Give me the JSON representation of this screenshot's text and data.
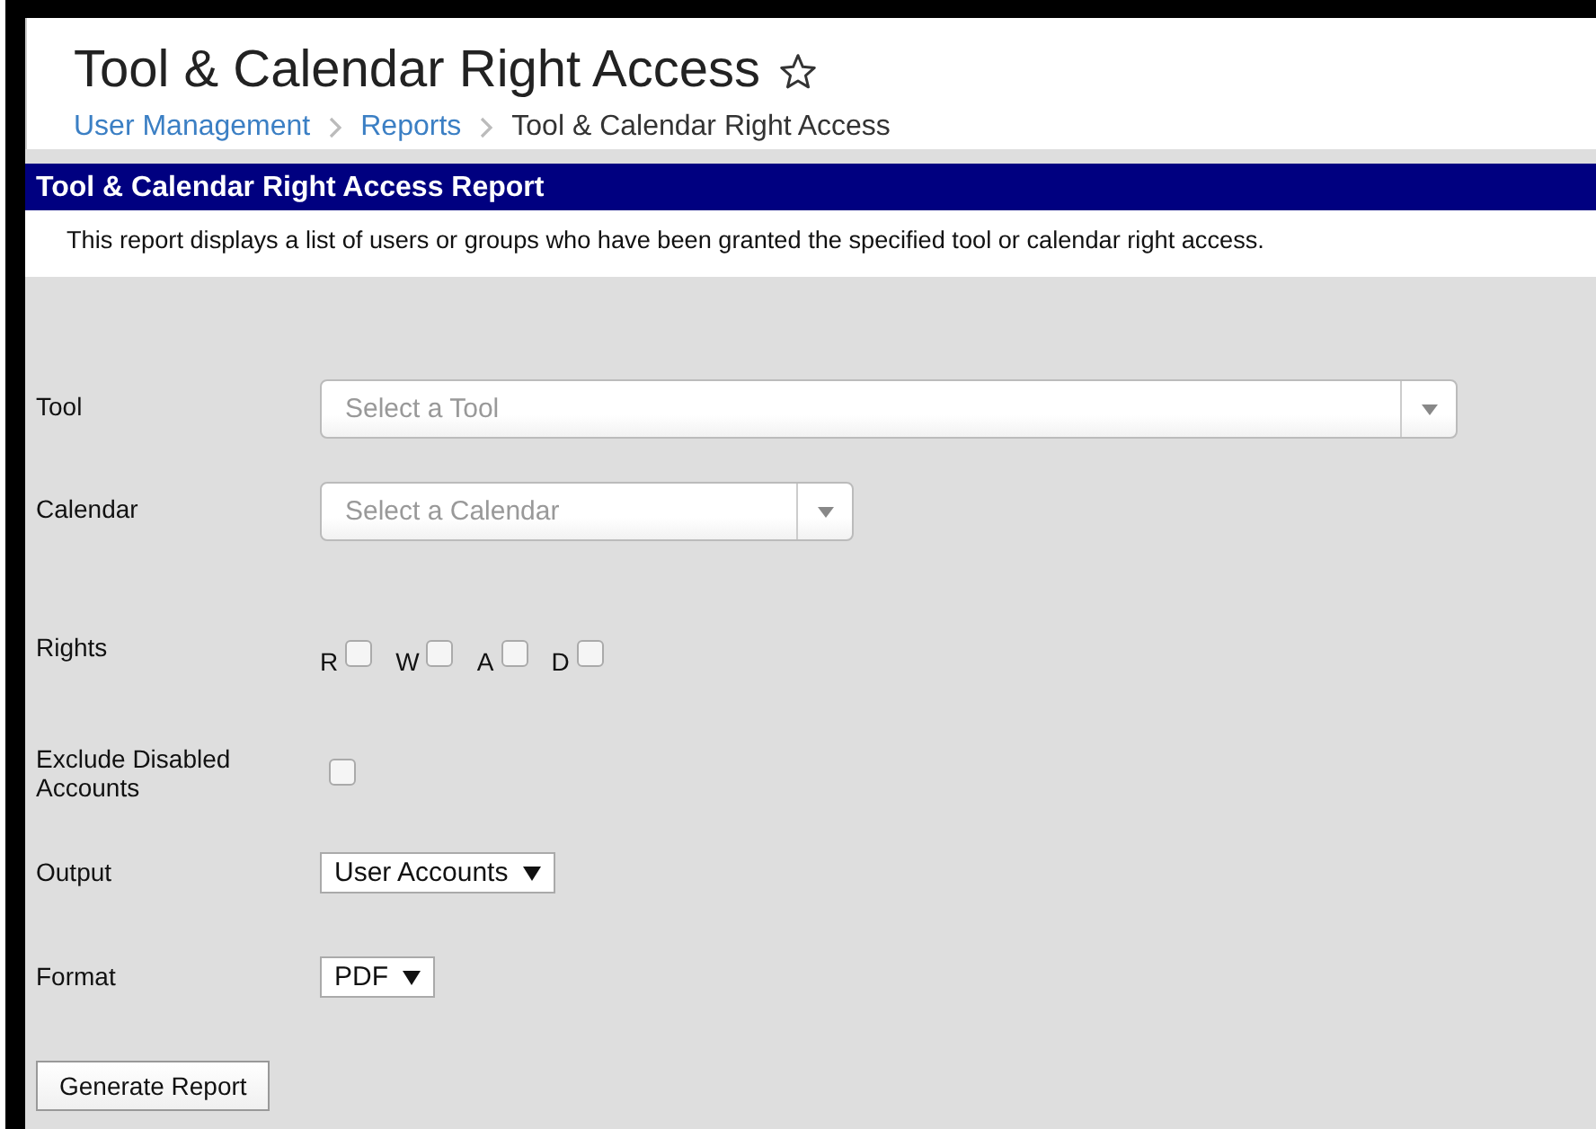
{
  "page": {
    "title": "Tool & Calendar Right Access",
    "favorite": false
  },
  "breadcrumb": [
    {
      "label": "User Management",
      "kind": "link"
    },
    {
      "label": "Reports",
      "kind": "link"
    },
    {
      "label": "Tool & Calendar Right Access",
      "kind": "current"
    }
  ],
  "report": {
    "header": "Tool & Calendar Right Access Report",
    "description": "This report displays a list of users or groups who have been granted the specified tool or calendar right access."
  },
  "fields": [
    {
      "kind": "combo",
      "label": "Tool",
      "placeholder": "Select a Tool"
    },
    {
      "kind": "short-combo",
      "label": "Calendar",
      "placeholder": "Select a Calendar"
    },
    {
      "kind": "rights",
      "label": "Rights",
      "options": [
        {
          "label": "R",
          "checked": false
        },
        {
          "label": "W",
          "checked": false
        },
        {
          "label": "A",
          "checked": false
        },
        {
          "label": "D",
          "checked": false
        }
      ]
    },
    {
      "kind": "checkbox",
      "label": "Exclude Disabled Accounts",
      "checked": false
    },
    {
      "kind": "select",
      "label": "Output",
      "value": "User Accounts"
    },
    {
      "kind": "select",
      "label": "Format",
      "value": "PDF"
    }
  ],
  "button": "Generate Report"
}
